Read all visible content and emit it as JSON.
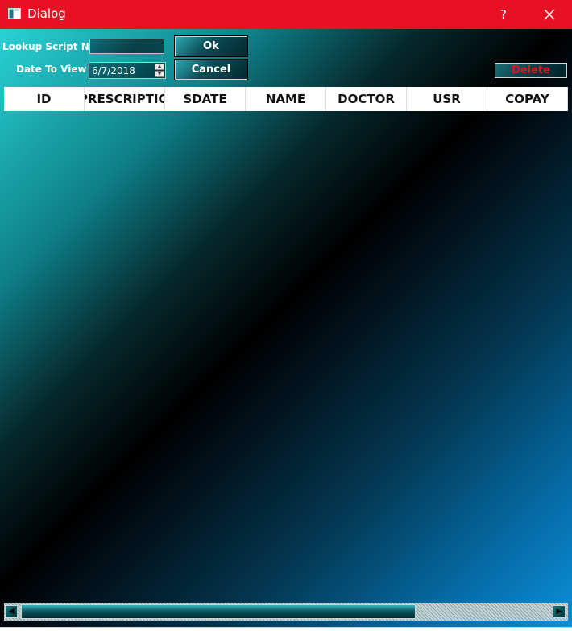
{
  "window": {
    "title": "Dialog",
    "help_label": "?"
  },
  "form": {
    "lookup_label": "Lookup Script No",
    "lookup_value": "",
    "date_label": "Date To View",
    "date_value": "6/7/2018",
    "ok_label": "Ok",
    "cancel_label": "Cancel",
    "delete_label": "Delete"
  },
  "grid": {
    "columns": [
      "ID",
      "PRESCRIPTIO",
      "SDATE",
      "NAME",
      "DOCTOR",
      "USR",
      "COPAY"
    ],
    "rows": []
  },
  "colors": {
    "titlebar": "#e81123",
    "delete_text": "#e81123",
    "gradient_start": "#29d3d6",
    "gradient_end": "#0c8fd9"
  },
  "icons": {
    "app": "app-window-icon",
    "close": "close-icon",
    "spin_up": "chevron-up-icon",
    "spin_down": "chevron-down-icon",
    "scroll_left": "arrow-left-icon",
    "scroll_right": "arrow-right-icon"
  }
}
